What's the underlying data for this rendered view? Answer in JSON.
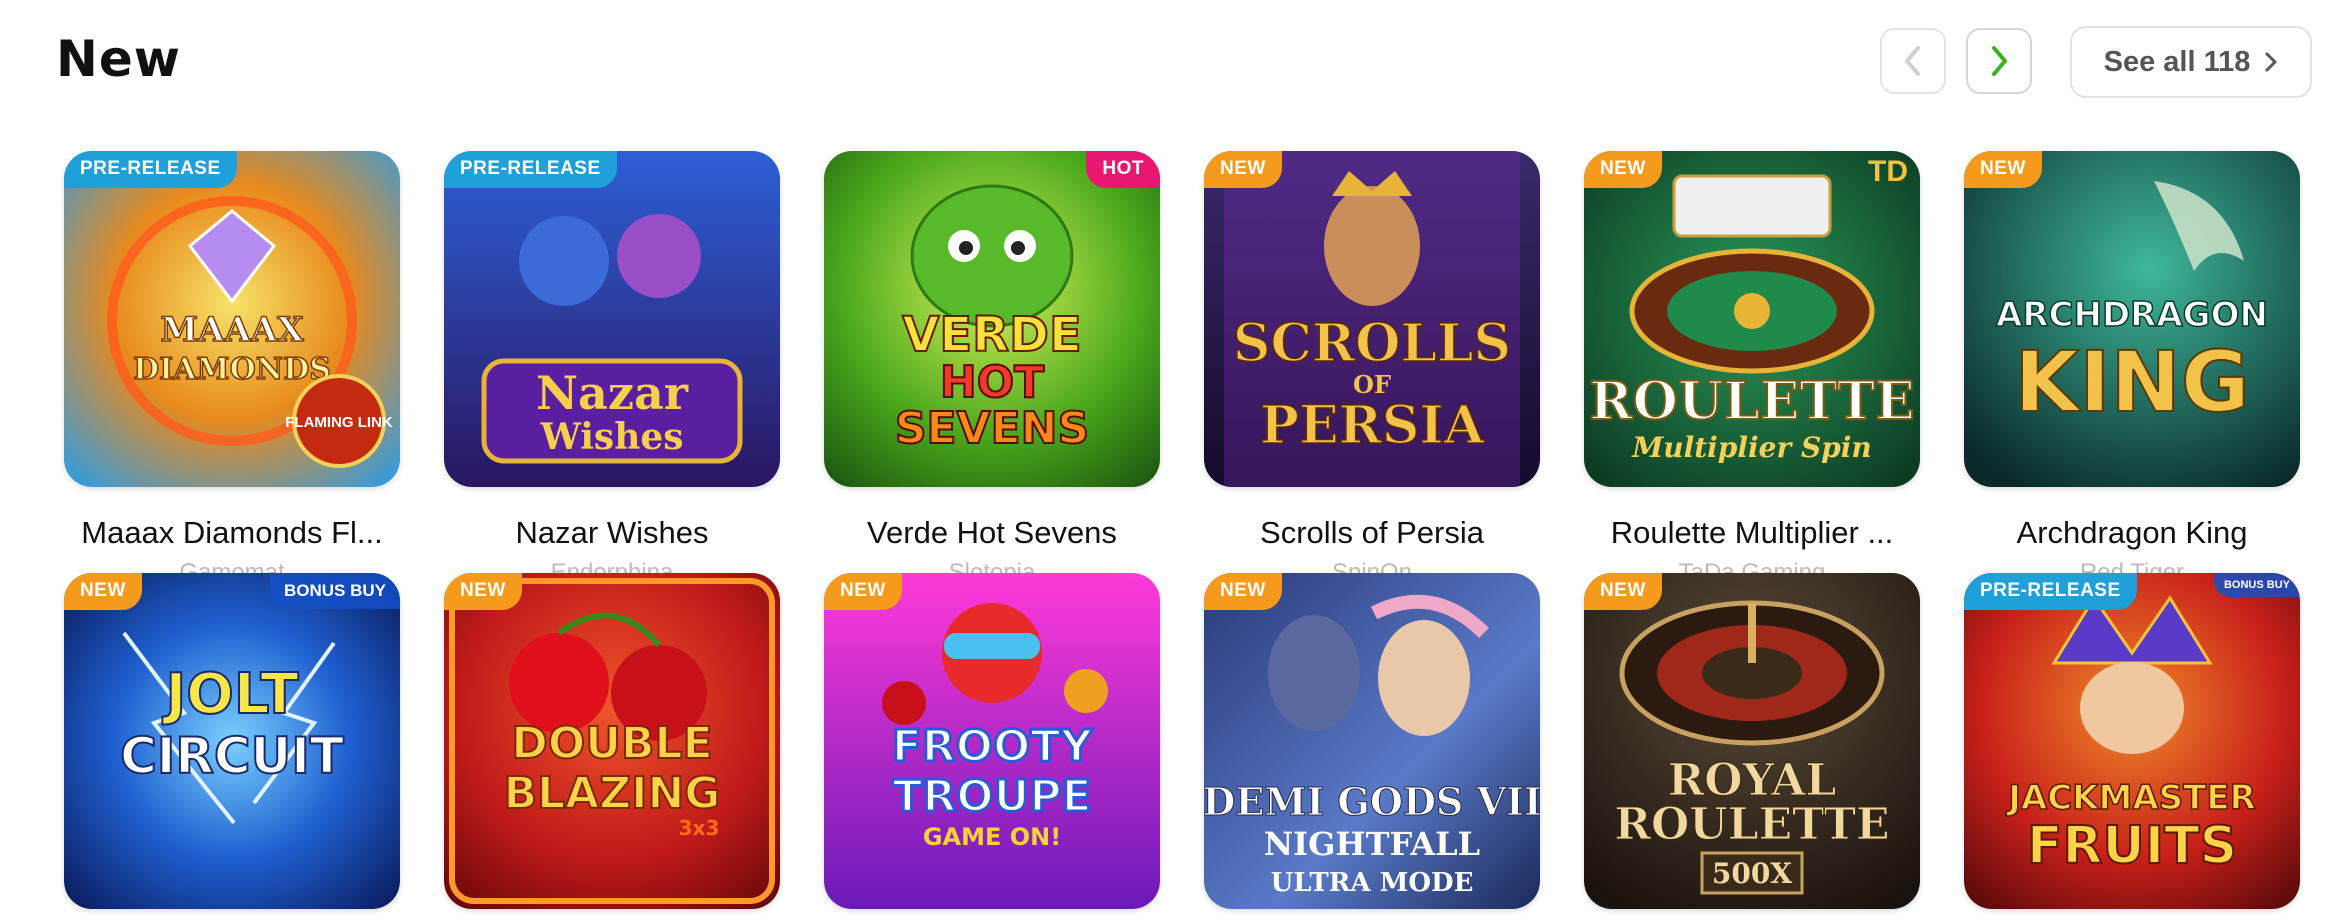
{
  "section": {
    "title": "New",
    "see_all_label": "See all 118"
  },
  "icons": {
    "prev": "chevron-left-icon",
    "next": "chevron-right-icon",
    "see_all": "chevron-right-icon"
  },
  "colors": {
    "accent_green": "#3bb023",
    "badge_new": "#f59a1b",
    "badge_pre": "#1fa0d8",
    "badge_hot": "#e8176f"
  },
  "games": [
    {
      "name": "Maaax Diamonds Fl...",
      "provider": "Gamomat",
      "badge": "PRE-RELEASE",
      "art": [
        "MAAAX",
        "DIAMONDS",
        "FLAMING LINK"
      ]
    },
    {
      "name": "Nazar Wishes",
      "provider": "Endorphina",
      "badge": "PRE-RELEASE",
      "art": [
        "Nazar",
        "Wishes"
      ]
    },
    {
      "name": "Verde Hot Sevens",
      "provider": "Slotopia",
      "badge": "HOT",
      "art": [
        "VERDE",
        "HOT",
        "SEVENS"
      ]
    },
    {
      "name": "Scrolls of Persia",
      "provider": "SpinOn",
      "badge": "NEW",
      "art": [
        "SCROLLS",
        "OF",
        "PERSIA"
      ]
    },
    {
      "name": "Roulette Multiplier ...",
      "provider": "TaDa Gaming",
      "badge": "NEW",
      "corner": "TD",
      "art": [
        "ROULETTE",
        "Multiplier Spin"
      ]
    },
    {
      "name": "Archdragon King",
      "provider": "Red Tiger",
      "badge": "NEW",
      "art": [
        "ARCHDRAGON",
        "KING"
      ]
    },
    {
      "name": "Jolt Circuit",
      "provider": "",
      "badge": "NEW",
      "corner": "BONUS BUY",
      "art": [
        "JOLT",
        "CIRCUIT"
      ]
    },
    {
      "name": "Double Blazing",
      "provider": "",
      "badge": "NEW",
      "art": [
        "DOUBLE",
        "BLAZING",
        "3x3"
      ]
    },
    {
      "name": "Frooty Troupe",
      "provider": "",
      "badge": "NEW",
      "art": [
        "FROOTY",
        "TROUPE",
        "GAME ON!"
      ]
    },
    {
      "name": "Demi Gods VII Nightfall",
      "provider": "",
      "badge": "NEW",
      "art": [
        "DEMI GODS VII",
        "NIGHTFALL",
        "ULTRA MODE"
      ]
    },
    {
      "name": "Royal Roulette 500X",
      "provider": "",
      "badge": "NEW",
      "art": [
        "ROYAL",
        "ROULETTE",
        "500X"
      ]
    },
    {
      "name": "Jackmaster Fruits",
      "provider": "",
      "badge": "PRE-RELEASE",
      "corner": "BONUS BUY",
      "art": [
        "JACKMASTER",
        "FRUITS"
      ]
    }
  ]
}
